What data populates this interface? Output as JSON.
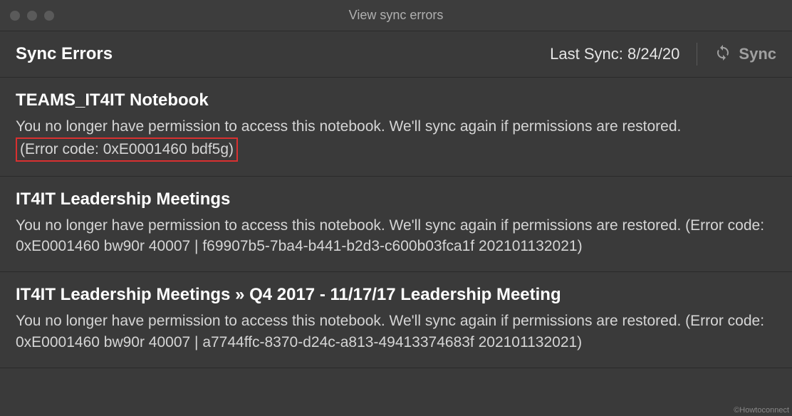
{
  "window": {
    "title": "View sync errors"
  },
  "header": {
    "title": "Sync Errors",
    "last_sync_label": "Last Sync: 8/24/20",
    "sync_button_label": "Sync"
  },
  "errors": [
    {
      "title": "TEAMS_IT4IT Notebook",
      "desc_prefix": "You no longer have permission to access this notebook. We'll sync again if permissions are restored. ",
      "error_code": "(Error code: 0xE0001460 bdf5g)",
      "highlighted": true
    },
    {
      "title": "IT4IT Leadership Meetings",
      "desc_prefix": "You no longer have permission to access this notebook. We'll sync again if permissions are restored. ",
      "error_code": "(Error code: 0xE0001460 bw90r 40007 | f69907b5-7ba4-b441-b2d3-c600b03fca1f 202101132021)",
      "highlighted": false
    },
    {
      "title": "IT4IT Leadership Meetings » Q4 2017 - 11/17/17 Leadership Meeting",
      "desc_prefix": "You no longer have permission to access this notebook. We'll sync again if permissions are restored. ",
      "error_code": "(Error code: 0xE0001460 bw90r 40007 | a7744ffc-8370-d24c-a813-49413374683f 202101132021)",
      "highlighted": false
    }
  ],
  "watermark": "©Howtoconnect"
}
